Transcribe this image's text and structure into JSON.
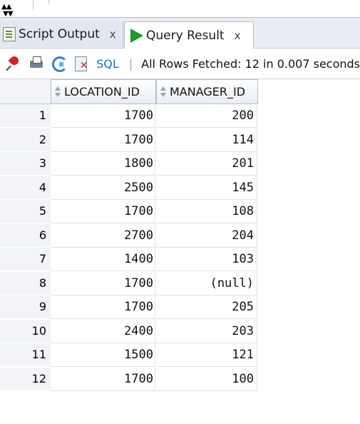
{
  "tabs": [
    {
      "label": "Script Output",
      "close": "x"
    },
    {
      "label": "Query Result",
      "close": "x"
    }
  ],
  "toolbar": {
    "sql_label": "SQL",
    "separator": "|",
    "status": "All Rows Fetched: 12 in 0.007 seconds"
  },
  "grid": {
    "columns": [
      "LOCATION_ID",
      "MANAGER_ID"
    ],
    "rows": [
      {
        "n": "1",
        "location_id": "1700",
        "manager_id": "200"
      },
      {
        "n": "2",
        "location_id": "1700",
        "manager_id": "114"
      },
      {
        "n": "3",
        "location_id": "1800",
        "manager_id": "201"
      },
      {
        "n": "4",
        "location_id": "2500",
        "manager_id": "145"
      },
      {
        "n": "5",
        "location_id": "1700",
        "manager_id": "108"
      },
      {
        "n": "6",
        "location_id": "2700",
        "manager_id": "204"
      },
      {
        "n": "7",
        "location_id": "1400",
        "manager_id": "103"
      },
      {
        "n": "8",
        "location_id": "1700",
        "manager_id": "(null)"
      },
      {
        "n": "9",
        "location_id": "1700",
        "manager_id": "205"
      },
      {
        "n": "10",
        "location_id": "2400",
        "manager_id": "203"
      },
      {
        "n": "11",
        "location_id": "1500",
        "manager_id": "121"
      },
      {
        "n": "12",
        "location_id": "1700",
        "manager_id": "100"
      }
    ]
  }
}
